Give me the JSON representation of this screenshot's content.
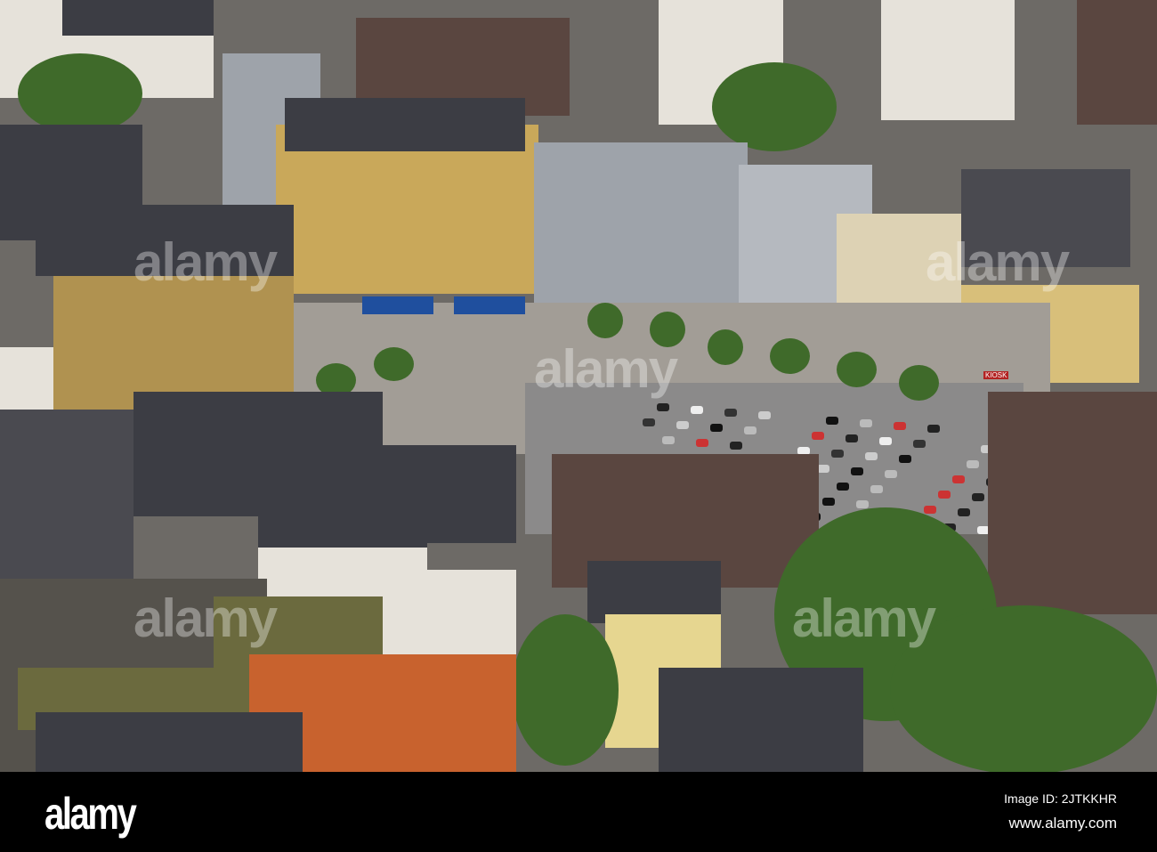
{
  "watermark": {
    "text": "alamy"
  },
  "signs": {
    "kiosk": "KIOSK"
  },
  "footer": {
    "logo": "alamy",
    "image_id": "Image ID: 2JTKKHR",
    "url": "www.alamy.com"
  }
}
